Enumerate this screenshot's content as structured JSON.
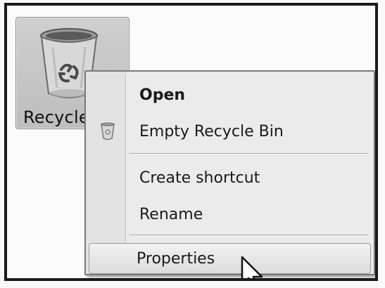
{
  "desktop": {
    "icon_label": "Recycle"
  },
  "context_menu": {
    "items": [
      {
        "label": "Open",
        "bold": true
      },
      {
        "label": "Empty Recycle Bin"
      },
      {
        "label": "Create shortcut"
      },
      {
        "label": "Rename"
      },
      {
        "label": "Properties",
        "highlighted": true
      }
    ]
  },
  "icons": {
    "desktop_icon": "recycle-bin-icon",
    "menu_icon": "recycle-bin-icon",
    "cursor": "mouse-pointer-icon"
  }
}
